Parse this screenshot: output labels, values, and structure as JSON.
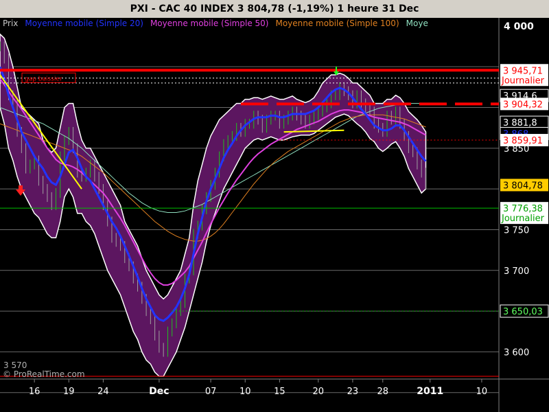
{
  "header": {
    "title": "PXI - CAC 40 INDEX     3 804,78 (-1,19%)     1 heure  31 Dec"
  },
  "legend": [
    {
      "label": "Prix",
      "color": "#c8c8c8"
    },
    {
      "label": "Moyenne mobile (Simple 20)",
      "color": "#2233ff"
    },
    {
      "label": "Moyenne mobile (Simple 50)",
      "color": "#e040e0"
    },
    {
      "label": "Moyenne mobile (Simple 100)",
      "color": "#e08020"
    },
    {
      "label": "Moye",
      "color": "#90e0c0"
    }
  ],
  "copyright": "© ProRealTime.com",
  "min_label": "3 570",
  "chart_data": {
    "type": "line",
    "title": "PXI - CAC 40 INDEX",
    "ylim": [
      3570,
      4010
    ],
    "xlim": [
      0,
      116
    ],
    "x_ticks": [
      {
        "x": 8,
        "label": "16",
        "bold": false
      },
      {
        "x": 16,
        "label": "19",
        "bold": false
      },
      {
        "x": 24,
        "label": "24",
        "bold": false
      },
      {
        "x": 37,
        "label": "Dec",
        "bold": true
      },
      {
        "x": 49,
        "label": "07",
        "bold": false
      },
      {
        "x": 57,
        "label": "10",
        "bold": false
      },
      {
        "x": 65,
        "label": "15",
        "bold": false
      },
      {
        "x": 74,
        "label": "20",
        "bold": false
      },
      {
        "x": 82,
        "label": "23",
        "bold": false
      },
      {
        "x": 89,
        "label": "28",
        "bold": false
      },
      {
        "x": 100,
        "label": "2011",
        "bold": true
      },
      {
        "x": 112,
        "label": "10",
        "bold": false
      }
    ],
    "y_ticks": [
      {
        "value": 4000,
        "label": "4 000",
        "bold": true
      },
      {
        "value": 3850,
        "label": "3 850",
        "bold": false
      },
      {
        "value": 3750,
        "label": "3 750",
        "bold": false
      },
      {
        "value": 3700,
        "label": "3 700",
        "bold": false
      },
      {
        "value": 3600,
        "label": "3 600",
        "bold": false
      }
    ],
    "grid_levels": [
      3950,
      3900,
      3850,
      3800,
      3750,
      3700,
      3650,
      3600,
      3550
    ],
    "price_labels": [
      {
        "value": 3945.71,
        "label": "3 945,71",
        "sub": "Journalier",
        "bg": "#ffffff",
        "fg": "#ff0000"
      },
      {
        "value": 3914.6,
        "label": "3 914,6",
        "bg": "#000000",
        "fg": "#ffffff"
      },
      {
        "value": 3904.32,
        "label": "3 904,32",
        "bg": "#ffffff",
        "fg": "#ff0000"
      },
      {
        "value": 3881.8,
        "label": "3 881,8",
        "bg": "#000000",
        "fg": "#ffffff"
      },
      {
        "value": 3868.0,
        "label": "3 868",
        "bg": "#000000",
        "fg": "#2233ff"
      },
      {
        "value": 3859.91,
        "label": "3 859,91",
        "bg": "#ffffff",
        "fg": "#ff0000"
      },
      {
        "value": 3804.78,
        "label": "3 804,78",
        "bg": "#ffcc00",
        "fg": "#000000"
      },
      {
        "value": 3776.38,
        "label": "3 776,38",
        "sub": "Journalier",
        "bg": "#ffffff",
        "fg": "#00a000"
      },
      {
        "value": 3650.03,
        "label": "3 650,03",
        "bg": "#000000",
        "fg": "#60ff60"
      }
    ],
    "hlines": [
      {
        "value": 3945.71,
        "color": "#ff0000",
        "style": "solid",
        "width": 4
      },
      {
        "value": 3936,
        "color": "#ffffff",
        "style": "dotted",
        "width": 1
      },
      {
        "value": 3930,
        "color": "#ffffff",
        "style": "dotted",
        "width": 1
      },
      {
        "value": 3904.32,
        "color": "#ff0000",
        "style": "dashed-thick",
        "width": 4,
        "x_from": 56
      },
      {
        "value": 3859.91,
        "color": "#ff0000",
        "style": "dotted",
        "width": 1,
        "x_from": 65
      },
      {
        "value": 3776.38,
        "color": "#00c000",
        "style": "solid",
        "width": 1
      },
      {
        "value": 3650.03,
        "color": "#00c000",
        "style": "dotted",
        "width": 1,
        "x_from": 40
      },
      {
        "value": 3570,
        "color": "#ff0000",
        "style": "solid",
        "width": 1
      }
    ],
    "annotation": {
      "label": "gap baissier",
      "color": "#ff0000"
    },
    "close": [
      3975,
      3960,
      3915,
      3905,
      3870,
      3850,
      3825,
      3830,
      3835,
      3810,
      3800,
      3790,
      3780,
      3795,
      3840,
      3860,
      3870,
      3850,
      3820,
      3815,
      3820,
      3830,
      3815,
      3800,
      3780,
      3760,
      3740,
      3735,
      3730,
      3715,
      3705,
      3690,
      3680,
      3665,
      3650,
      3640,
      3620,
      3605,
      3600,
      3625,
      3635,
      3650,
      3660,
      3690,
      3700,
      3745,
      3755,
      3775,
      3790,
      3805,
      3820,
      3840,
      3855,
      3860,
      3865,
      3875,
      3870,
      3880,
      3880,
      3890,
      3885,
      3875,
      3885,
      3890,
      3890,
      3880,
      3885,
      3890,
      3895,
      3890,
      3885,
      3880,
      3885,
      3890,
      3895,
      3900,
      3905,
      3915,
      3915,
      3925,
      3920,
      3915,
      3905,
      3915,
      3905,
      3900,
      3895,
      3880,
      3875,
      3870,
      3890,
      3885,
      3895,
      3880,
      3865,
      3850,
      3845,
      3830,
      3820,
      3804.78
    ],
    "bb_upper": [
      3990,
      3985,
      3970,
      3950,
      3925,
      3900,
      3895,
      3890,
      3885,
      3880,
      3860,
      3850,
      3845,
      3850,
      3875,
      3900,
      3905,
      3905,
      3880,
      3860,
      3850,
      3850,
      3840,
      3830,
      3820,
      3810,
      3800,
      3790,
      3780,
      3760,
      3750,
      3740,
      3730,
      3715,
      3700,
      3690,
      3680,
      3670,
      3665,
      3670,
      3680,
      3690,
      3700,
      3720,
      3740,
      3780,
      3810,
      3830,
      3850,
      3865,
      3875,
      3885,
      3890,
      3895,
      3900,
      3905,
      3905,
      3910,
      3910,
      3912,
      3912,
      3910,
      3912,
      3914,
      3912,
      3910,
      3910,
      3912,
      3914,
      3910,
      3908,
      3906,
      3908,
      3912,
      3920,
      3930,
      3935,
      3940,
      3940,
      3942,
      3940,
      3936,
      3930,
      3930,
      3925,
      3920,
      3915,
      3905,
      3905,
      3905,
      3910,
      3910,
      3915,
      3912,
      3905,
      3895,
      3890,
      3885,
      3878,
      3870
    ],
    "bb_lower": [
      3900,
      3880,
      3850,
      3835,
      3815,
      3800,
      3790,
      3780,
      3770,
      3765,
      3755,
      3745,
      3740,
      3740,
      3760,
      3790,
      3800,
      3790,
      3770,
      3770,
      3760,
      3755,
      3745,
      3730,
      3715,
      3700,
      3690,
      3680,
      3670,
      3655,
      3640,
      3625,
      3615,
      3600,
      3590,
      3585,
      3575,
      3570,
      3570,
      3580,
      3590,
      3600,
      3615,
      3630,
      3650,
      3670,
      3690,
      3710,
      3735,
      3755,
      3770,
      3785,
      3800,
      3810,
      3820,
      3830,
      3840,
      3850,
      3855,
      3860,
      3862,
      3860,
      3862,
      3864,
      3862,
      3860,
      3860,
      3862,
      3864,
      3865,
      3866,
      3866,
      3866,
      3868,
      3872,
      3876,
      3880,
      3884,
      3888,
      3890,
      3892,
      3890,
      3885,
      3880,
      3876,
      3870,
      3862,
      3858,
      3850,
      3846,
      3850,
      3855,
      3858,
      3850,
      3840,
      3825,
      3815,
      3805,
      3795,
      3800
    ],
    "sma20": [
      3950,
      3935,
      3915,
      3900,
      3885,
      3870,
      3860,
      3850,
      3840,
      3832,
      3825,
      3815,
      3808,
      3805,
      3815,
      3830,
      3845,
      3848,
      3838,
      3825,
      3815,
      3810,
      3800,
      3790,
      3780,
      3770,
      3760,
      3752,
      3742,
      3730,
      3718,
      3705,
      3692,
      3678,
      3665,
      3655,
      3645,
      3640,
      3638,
      3642,
      3648,
      3655,
      3665,
      3678,
      3695,
      3720,
      3745,
      3765,
      3785,
      3800,
      3812,
      3825,
      3838,
      3848,
      3856,
      3865,
      3872,
      3878,
      3882,
      3886,
      3888,
      3888,
      3888,
      3890,
      3890,
      3888,
      3888,
      3890,
      3892,
      3892,
      3892,
      3892,
      3894,
      3896,
      3900,
      3906,
      3912,
      3918,
      3922,
      3924,
      3922,
      3918,
      3912,
      3905,
      3898,
      3892,
      3885,
      3878,
      3875,
      3872,
      3872,
      3874,
      3878,
      3878,
      3872,
      3864,
      3856,
      3848,
      3840,
      3834
    ],
    "sma50": [
      3935,
      3928,
      3920,
      3912,
      3905,
      3898,
      3890,
      3882,
      3874,
      3866,
      3858,
      3850,
      3843,
      3836,
      3832,
      3830,
      3829,
      3827,
      3824,
      3820,
      3815,
      3810,
      3805,
      3800,
      3795,
      3788,
      3780,
      3772,
      3764,
      3755,
      3745,
      3735,
      3725,
      3715,
      3705,
      3697,
      3690,
      3685,
      3682,
      3682,
      3684,
      3688,
      3693,
      3698,
      3705,
      3715,
      3725,
      3735,
      3746,
      3757,
      3767,
      3777,
      3786,
      3795,
      3803,
      3811,
      3818,
      3825,
      3832,
      3838,
      3843,
      3847,
      3851,
      3855,
      3858,
      3861,
      3864,
      3867,
      3870,
      3873,
      3875,
      3877,
      3879,
      3881,
      3883,
      3886,
      3889,
      3892,
      3894,
      3896,
      3897,
      3897,
      3896,
      3895,
      3894,
      3892,
      3890,
      3888,
      3887,
      3886,
      3885,
      3884,
      3883,
      3882,
      3880,
      3878,
      3875,
      3872,
      3869,
      3866
    ],
    "sma100": [
      3880,
      3878,
      3876,
      3874,
      3872,
      3870,
      3868,
      3866,
      3864,
      3862,
      3860,
      3858,
      3856,
      3854,
      3852,
      3850,
      3848,
      3846,
      3843,
      3840,
      3836,
      3832,
      3828,
      3824,
      3820,
      3815,
      3810,
      3805,
      3800,
      3795,
      3790,
      3785,
      3780,
      3775,
      3770,
      3765,
      3760,
      3756,
      3752,
      3748,
      3745,
      3742,
      3740,
      3738,
      3737,
      3736,
      3736,
      3737,
      3739,
      3742,
      3746,
      3751,
      3757,
      3764,
      3771,
      3778,
      3785,
      3792,
      3799,
      3806,
      3812,
      3818,
      3824,
      3829,
      3834,
      3838,
      3842,
      3846,
      3849,
      3852,
      3855,
      3858,
      3861,
      3864,
      3867,
      3870,
      3873,
      3876,
      3879,
      3882,
      3884,
      3886,
      3888,
      3889,
      3890,
      3891,
      3891,
      3891,
      3891,
      3891,
      3890,
      3889,
      3888,
      3887,
      3886,
      3884,
      3882,
      3880,
      3878,
      3876
    ],
    "sma200": [
      3900,
      3898,
      3896,
      3894,
      3892,
      3890,
      3888,
      3886,
      3884,
      3882,
      3880,
      3877,
      3874,
      3871,
      3868,
      3865,
      3862,
      3858,
      3854,
      3850,
      3845,
      3840,
      3835,
      3830,
      3825,
      3820,
      3815,
      3810,
      3805,
      3800,
      3795,
      3791,
      3787,
      3783,
      3780,
      3777,
      3775,
      3773,
      3772,
      3771,
      3771,
      3771,
      3772,
      3773,
      3775,
      3777,
      3779,
      3781,
      3784,
      3787,
      3790,
      3793,
      3796,
      3799,
      3802,
      3805,
      3808,
      3811,
      3814,
      3817,
      3820,
      3823,
      3826,
      3829,
      3832,
      3835,
      3838,
      3841,
      3844,
      3847,
      3850,
      3853,
      3856,
      3859,
      3862,
      3865,
      3868,
      3871,
      3874,
      3877,
      3880,
      3883,
      3886,
      3889,
      3891,
      3893,
      3895,
      3897,
      3899,
      3900,
      3901,
      3902,
      3903,
      3904,
      3904,
      3905,
      3905,
      3905,
      3905,
      3905
    ]
  }
}
